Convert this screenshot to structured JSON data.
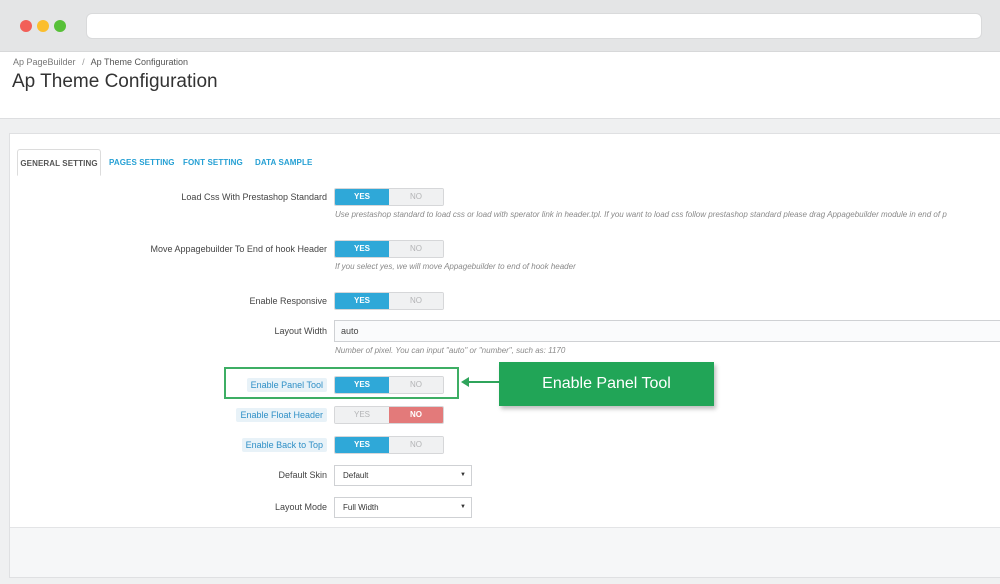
{
  "browser": {
    "url": ""
  },
  "breadcrumb": {
    "parent": "Ap PageBuilder",
    "separator": "/",
    "current": "Ap Theme Configuration"
  },
  "page_title": "Ap Theme Configuration",
  "tabs": [
    {
      "label": "GENERAL SETTING",
      "active": true
    },
    {
      "label": "PAGES SETTING",
      "active": false
    },
    {
      "label": "FONT SETTING",
      "active": false
    },
    {
      "label": "DATA SAMPLE",
      "active": false
    }
  ],
  "form": {
    "load_css": {
      "label": "Load Css With Prestashop Standard",
      "yes": "YES",
      "no": "NO",
      "value": "YES",
      "help": "Use prestashop standard to load css or load with sperator link in header.tpl. If you want to load css follow prestashop standard please drag Appagebuilder module in end of p"
    },
    "move_appagebuilder": {
      "label": "Move Appagebuilder To End of hook Header",
      "yes": "YES",
      "no": "NO",
      "value": "YES",
      "help": "If you select yes, we will move Appagebuilder to end of hook header"
    },
    "responsive": {
      "label": "Enable Responsive",
      "yes": "YES",
      "no": "NO",
      "value": "YES"
    },
    "layout_width": {
      "label": "Layout Width",
      "value": "auto",
      "help": "Number of pixel. You can input \"auto\" or \"number\", such as: 1170"
    },
    "panel_tool": {
      "label": "Enable Panel Tool",
      "yes": "YES",
      "no": "NO",
      "value": "YES"
    },
    "float_header": {
      "label": "Enable Float Header",
      "yes": "YES",
      "no": "NO",
      "value": "NO"
    },
    "back_to_top": {
      "label": "Enable Back to Top",
      "yes": "YES",
      "no": "NO",
      "value": "YES"
    },
    "default_skin": {
      "label": "Default Skin",
      "value": "Default"
    },
    "layout_mode": {
      "label": "Layout Mode",
      "value": "Full Width"
    }
  },
  "callout": {
    "text": "Enable Panel Tool"
  },
  "colors": {
    "accent": "#2fa8d8",
    "no_active": "#e37a7a",
    "callout": "#21a557"
  }
}
